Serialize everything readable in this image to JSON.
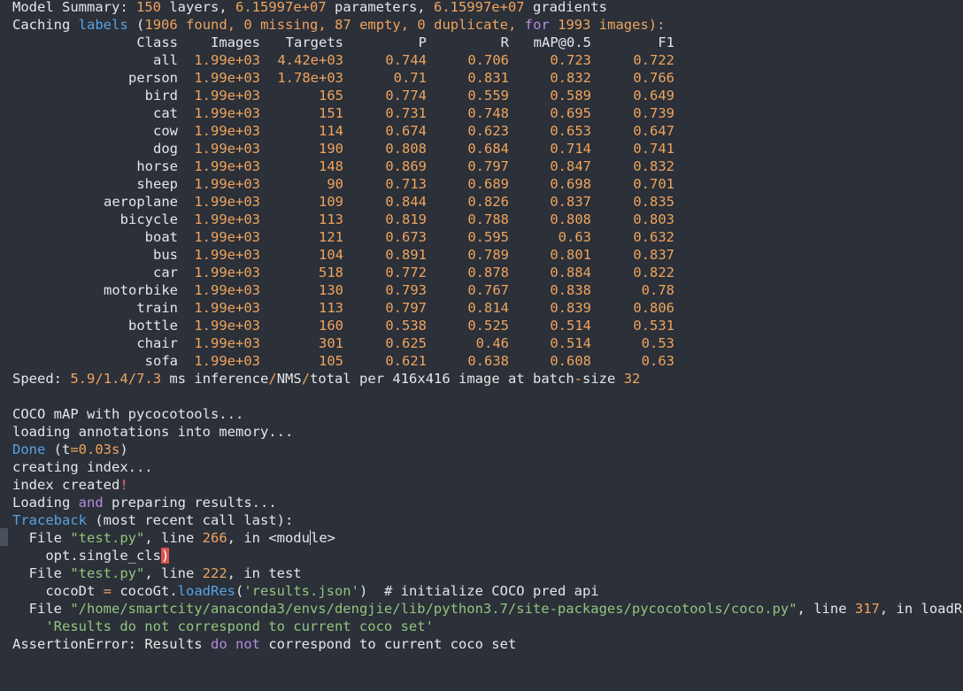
{
  "summary": {
    "l1": "Model Summary:",
    "layers": "150",
    "l2": " layers,",
    "params": "6.15997e+07",
    "l3": " parameters,",
    "grads": "6.15997e+07",
    "l4": " gradients"
  },
  "caching": {
    "c1": "Caching",
    "c2": "labels",
    "c3": "(",
    "found": "1906",
    "c4": "found,",
    "missing": "0",
    "c5": "missing,",
    "empty": "87",
    "c6": "empty,",
    "duplicate": "0",
    "c7": "duplicate,",
    "for_kw": "for",
    "images": "1993",
    "c8": "images):"
  },
  "table": {
    "headers": [
      "Class",
      "Images",
      "Targets",
      "P",
      "R",
      "mAP@0.5",
      "F1"
    ],
    "rows": [
      [
        "all",
        "1.99e+03",
        "4.42e+03",
        "0.744",
        "0.706",
        "0.723",
        "0.722"
      ],
      [
        "person",
        "1.99e+03",
        "1.78e+03",
        "0.71",
        "0.831",
        "0.832",
        "0.766"
      ],
      [
        "bird",
        "1.99e+03",
        "165",
        "0.774",
        "0.559",
        "0.589",
        "0.649"
      ],
      [
        "cat",
        "1.99e+03",
        "151",
        "0.731",
        "0.748",
        "0.695",
        "0.739"
      ],
      [
        "cow",
        "1.99e+03",
        "114",
        "0.674",
        "0.623",
        "0.653",
        "0.647"
      ],
      [
        "dog",
        "1.99e+03",
        "190",
        "0.808",
        "0.684",
        "0.714",
        "0.741"
      ],
      [
        "horse",
        "1.99e+03",
        "148",
        "0.869",
        "0.797",
        "0.847",
        "0.832"
      ],
      [
        "sheep",
        "1.99e+03",
        "90",
        "0.713",
        "0.689",
        "0.698",
        "0.701"
      ],
      [
        "aeroplane",
        "1.99e+03",
        "109",
        "0.844",
        "0.826",
        "0.837",
        "0.835"
      ],
      [
        "bicycle",
        "1.99e+03",
        "113",
        "0.819",
        "0.788",
        "0.808",
        "0.803"
      ],
      [
        "boat",
        "1.99e+03",
        "121",
        "0.673",
        "0.595",
        "0.63",
        "0.632"
      ],
      [
        "bus",
        "1.99e+03",
        "104",
        "0.891",
        "0.789",
        "0.801",
        "0.837"
      ],
      [
        "car",
        "1.99e+03",
        "518",
        "0.772",
        "0.878",
        "0.884",
        "0.822"
      ],
      [
        "motorbike",
        "1.99e+03",
        "130",
        "0.793",
        "0.767",
        "0.838",
        "0.78"
      ],
      [
        "train",
        "1.99e+03",
        "113",
        "0.797",
        "0.814",
        "0.839",
        "0.806"
      ],
      [
        "bottle",
        "1.99e+03",
        "160",
        "0.538",
        "0.525",
        "0.514",
        "0.531"
      ],
      [
        "chair",
        "1.99e+03",
        "301",
        "0.625",
        "0.46",
        "0.514",
        "0.53"
      ],
      [
        "sofa",
        "1.99e+03",
        "105",
        "0.621",
        "0.638",
        "0.608",
        "0.63"
      ]
    ]
  },
  "speed": {
    "s1": "Speed:",
    "v1": "5.9",
    "sl1": "/",
    "v2": "1.4",
    "sl2": "/",
    "v3": "7.3",
    "s2": " ms inference",
    "sl3": "/",
    "s3": "NMS",
    "sl4": "/",
    "s4": "total per 416x416 image at batch",
    "dash": "-",
    "s5": "size",
    "batch": "32"
  },
  "coco": {
    "map_line": "COCO mAP with pycocotools...",
    "loading_ann": "loading annotations into memory...",
    "done": "Done",
    "done_p1": " (t",
    "eq": "=",
    "done_t": "0.03s",
    "done_p2": ")",
    "creating": "creating index...",
    "index_created": "index created",
    "bang": "!",
    "lp1": "Loading",
    "lp_and": "and",
    "lp2": "preparing results..."
  },
  "traceback": {
    "tb": "Traceback",
    "tb2": " (most recent call last):",
    "f1_pre": "  File ",
    "f1_file": "\"test.py\"",
    "f1_mid": ", line ",
    "f1_line": "266",
    "f1_a": ", in <modu",
    "f1_b": "le>",
    "code1": "    opt.single_cls",
    "paren": ")",
    "f2_pre": "  File ",
    "f2_file": "\"test.py\"",
    "f2_mid": ", line ",
    "f2_line": "222",
    "f2_post": ", in test",
    "code2_a": "    cocoDt ",
    "code2_eq": "=",
    "code2_b": " cocoGt.",
    "code2_fn": "loadRes",
    "code2_c": "(",
    "code2_str": "'results.json'",
    "code2_d": ")  # initialize COCO pred api",
    "f3_pre": "  File ",
    "f3_file": "\"/home/smartcity/anaconda3/envs/dengjie/lib/python3.7/site-packages/pycocotools/coco.py\"",
    "f3_mid": ", line ",
    "f3_line": "317",
    "f3_post": ", in loadR",
    "code3": "    'Results do not correspond to current coco set'",
    "err": "AssertionError:",
    "err2": " Results ",
    "err_do": "do",
    "err_not": "not",
    "err3": " correspond to current coco set"
  }
}
